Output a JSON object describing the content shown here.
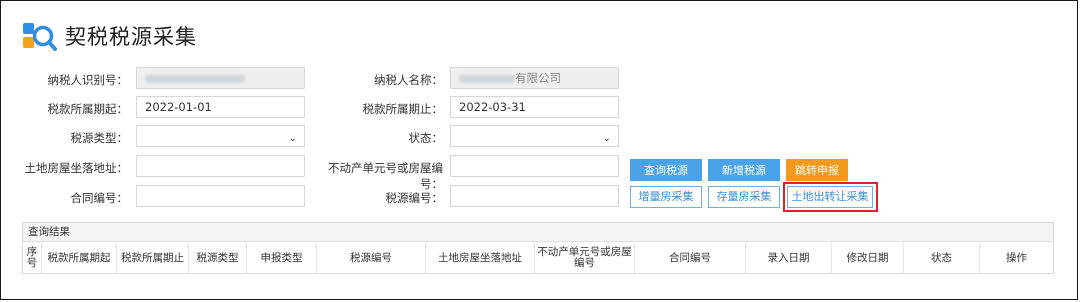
{
  "page": {
    "title": "契税税源采集"
  },
  "form": {
    "taxpayer_id": {
      "label": "纳税人识别号：",
      "value": ""
    },
    "taxpayer_name": {
      "label": "纳税人名称：",
      "value_suffix": "有限公司"
    },
    "period_start": {
      "label": "税款所属期起：",
      "value": "2022-01-01"
    },
    "period_end": {
      "label": "税款所属期止：",
      "value": "2022-03-31"
    },
    "source_type": {
      "label": "税源类型：",
      "value": ""
    },
    "status": {
      "label": "状态：",
      "value": ""
    },
    "land_address": {
      "label": "土地房屋坐落地址：",
      "value": ""
    },
    "unit_number": {
      "label": "不动产单元号或房屋编号：",
      "value": ""
    },
    "contract_no": {
      "label": "合同编号：",
      "value": ""
    },
    "source_no": {
      "label": "税源编号：",
      "value": ""
    }
  },
  "buttons": {
    "query": "查询税源",
    "add": "新增税源",
    "jump": "跳转申报",
    "incremental": "增量房采集",
    "stock": "存量房采集",
    "land_transfer": "土地出转让采集"
  },
  "colors": {
    "primary": "#4aa3e8",
    "orange": "#f39a1c",
    "highlight": "#d9232d"
  },
  "results": {
    "title": "查询结果",
    "columns": [
      "序号",
      "税款所属期起",
      "税款所属期止",
      "税源类型",
      "申报类型",
      "税源编号",
      "土地房屋坐落地址",
      "不动产单元号或房屋编号",
      "合同编号",
      "录入日期",
      "修改日期",
      "状态",
      "操作"
    ]
  }
}
